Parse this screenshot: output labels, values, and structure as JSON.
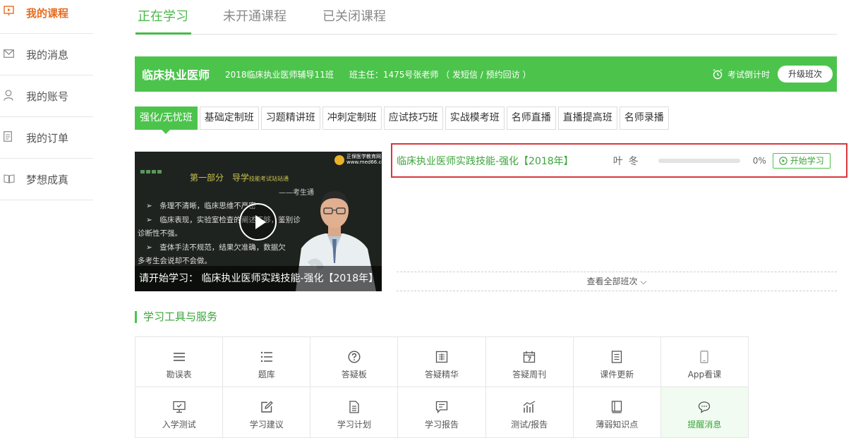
{
  "sidebar": {
    "items": [
      {
        "label": "我的课程",
        "icon": "course-screen-icon",
        "active": true
      },
      {
        "label": "我的消息",
        "icon": "envelope-icon"
      },
      {
        "label": "我的账号",
        "icon": "user-icon"
      },
      {
        "label": "我的订单",
        "icon": "order-list-icon"
      },
      {
        "label": "梦想成真",
        "icon": "open-book-icon"
      }
    ]
  },
  "top_tabs": [
    "正在学习",
    "未开通课程",
    "已关闭课程"
  ],
  "banner": {
    "title": "临床执业医师",
    "class_name": "2018临床执业医师辅导11班",
    "teacher": "班主任：1475号张老师 （ 发短信 / 预约回访 ）",
    "countdown": "考试倒计时",
    "upgrade": "升级班次"
  },
  "class_tabs": [
    "强化/无忧班",
    "基础定制班",
    "习题精讲班",
    "冲刺定制班",
    "应试技巧班",
    "实战模考班",
    "名师直播",
    "直播提高班",
    "名师录播"
  ],
  "video": {
    "heading": "第一部分　导学",
    "heading_small": "技能考试站站通",
    "sub": "——考生通",
    "logo_line1": "正保医学教育网",
    "logo_line2": "www.med66.com",
    "lines": [
      "➢　条理不清晰，临床思维不严密",
      "➢　临床表现，实验室检查的阐述不够，鉴别诊",
      "诊断性不强。",
      "➢　查体手法不规范，结果欠准确，数据欠",
      "多考生会说却不会做。"
    ],
    "caption": "请开始学习： 临床执业医师实践技能-强化【2018年】"
  },
  "course": {
    "title": "临床执业医师实践技能-强化【2018年】",
    "teacher": "叶冬",
    "progress_percent": 0,
    "progress_label": "0%",
    "start": "开始学习"
  },
  "view_all": "查看全部班次 ⌵",
  "tools": {
    "title": "学习工具与服务",
    "items": [
      {
        "label": "勘误表",
        "icon": "menu-lines-icon"
      },
      {
        "label": "题库",
        "icon": "bullet-list-icon"
      },
      {
        "label": "答疑板",
        "icon": "question-circle-icon"
      },
      {
        "label": "答疑精华",
        "icon": "essence-icon"
      },
      {
        "label": "答疑周刊",
        "icon": "calendar-7-icon"
      },
      {
        "label": "课件更新",
        "icon": "document-lines-icon"
      },
      {
        "label": "App看课",
        "icon": "phone-icon"
      },
      {
        "label": "入学测试",
        "icon": "monitor-icon"
      },
      {
        "label": "学习建议",
        "icon": "edit-icon"
      },
      {
        "label": "学习计划",
        "icon": "file-icon"
      },
      {
        "label": "学习报告",
        "icon": "report-icon"
      },
      {
        "label": "测试/报告",
        "icon": "bar-chart-icon"
      },
      {
        "label": "薄弱知识点",
        "icon": "notebook-icon"
      },
      {
        "label": "提醒消息",
        "icon": "chat-bubble-icon",
        "active": true
      }
    ]
  },
  "colors": {
    "accent": "#4cc44c",
    "accent_text": "#3aa53a",
    "sidebar_active": "#e86b1f",
    "highlight_border": "#d9363b"
  }
}
